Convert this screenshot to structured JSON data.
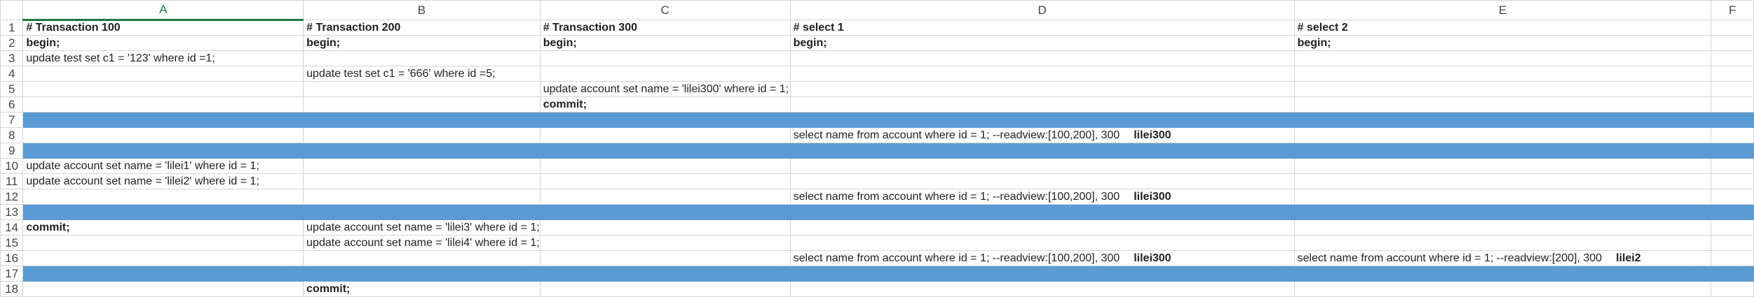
{
  "columns": [
    "A",
    "B",
    "C",
    "D",
    "E",
    "F"
  ],
  "rows": [
    {
      "num": "1",
      "band": false,
      "cells": [
        {
          "text": "# Transaction 100",
          "bold": true
        },
        {
          "text": "# Transaction 200",
          "bold": true
        },
        {
          "text": "# Transaction 300",
          "bold": true
        },
        {
          "text": "# select 1",
          "bold": true
        },
        {
          "text": "# select 2",
          "bold": true
        },
        {
          "text": ""
        }
      ]
    },
    {
      "num": "2",
      "band": false,
      "cells": [
        {
          "text": "begin;",
          "bold": true
        },
        {
          "text": "begin;",
          "bold": true
        },
        {
          "text": "begin;",
          "bold": true
        },
        {
          "text": "begin;",
          "bold": true
        },
        {
          "text": "begin;",
          "bold": true
        },
        {
          "text": ""
        }
      ]
    },
    {
      "num": "3",
      "band": false,
      "cells": [
        {
          "text": "update test set c1 = '123' where id =1;"
        },
        {
          "text": ""
        },
        {
          "text": ""
        },
        {
          "text": ""
        },
        {
          "text": ""
        },
        {
          "text": ""
        }
      ]
    },
    {
      "num": "4",
      "band": false,
      "cells": [
        {
          "text": ""
        },
        {
          "text": "update test set c1 = '666' where id =5;"
        },
        {
          "text": ""
        },
        {
          "text": ""
        },
        {
          "text": ""
        },
        {
          "text": ""
        }
      ]
    },
    {
      "num": "5",
      "band": false,
      "cells": [
        {
          "text": ""
        },
        {
          "text": ""
        },
        {
          "text": "update account set name = 'lilei300' where id = 1;"
        },
        {
          "text": ""
        },
        {
          "text": ""
        },
        {
          "text": ""
        }
      ]
    },
    {
      "num": "6",
      "band": false,
      "cells": [
        {
          "text": ""
        },
        {
          "text": ""
        },
        {
          "text": "commit;",
          "bold": true
        },
        {
          "text": ""
        },
        {
          "text": ""
        },
        {
          "text": ""
        }
      ]
    },
    {
      "num": "7",
      "band": true,
      "cells": [
        {
          "text": ""
        },
        {
          "text": ""
        },
        {
          "text": ""
        },
        {
          "text": ""
        },
        {
          "text": ""
        },
        {
          "text": ""
        }
      ]
    },
    {
      "num": "8",
      "band": false,
      "cells": [
        {
          "text": ""
        },
        {
          "text": ""
        },
        {
          "text": ""
        },
        {
          "text": "select name from account where id = 1;   --readview:[100,200], 300",
          "result": "lilei300"
        },
        {
          "text": ""
        },
        {
          "text": ""
        }
      ]
    },
    {
      "num": "9",
      "band": true,
      "cells": [
        {
          "text": ""
        },
        {
          "text": ""
        },
        {
          "text": ""
        },
        {
          "text": ""
        },
        {
          "text": ""
        },
        {
          "text": ""
        }
      ]
    },
    {
      "num": "10",
      "band": false,
      "cells": [
        {
          "text": "update account set name = 'lilei1' where id = 1;"
        },
        {
          "text": ""
        },
        {
          "text": ""
        },
        {
          "text": ""
        },
        {
          "text": ""
        },
        {
          "text": ""
        }
      ]
    },
    {
      "num": "11",
      "band": false,
      "cells": [
        {
          "text": "update account set name = 'lilei2' where id = 1;"
        },
        {
          "text": ""
        },
        {
          "text": ""
        },
        {
          "text": ""
        },
        {
          "text": ""
        },
        {
          "text": ""
        }
      ]
    },
    {
      "num": "12",
      "band": false,
      "cells": [
        {
          "text": ""
        },
        {
          "text": ""
        },
        {
          "text": ""
        },
        {
          "text": "select name from account where id = 1;   --readview:[100,200], 300",
          "result": "lilei300"
        },
        {
          "text": ""
        },
        {
          "text": ""
        }
      ]
    },
    {
      "num": "13",
      "band": true,
      "cells": [
        {
          "text": ""
        },
        {
          "text": ""
        },
        {
          "text": ""
        },
        {
          "text": ""
        },
        {
          "text": ""
        },
        {
          "text": ""
        }
      ]
    },
    {
      "num": "14",
      "band": false,
      "cells": [
        {
          "text": "commit;",
          "bold": true
        },
        {
          "text": "update account set name = 'lilei3' where id = 1;"
        },
        {
          "text": ""
        },
        {
          "text": ""
        },
        {
          "text": ""
        },
        {
          "text": ""
        }
      ]
    },
    {
      "num": "15",
      "band": false,
      "cells": [
        {
          "text": ""
        },
        {
          "text": "update account set name = 'lilei4' where id = 1;"
        },
        {
          "text": ""
        },
        {
          "text": ""
        },
        {
          "text": ""
        },
        {
          "text": ""
        }
      ]
    },
    {
      "num": "16",
      "band": false,
      "cells": [
        {
          "text": ""
        },
        {
          "text": ""
        },
        {
          "text": ""
        },
        {
          "text": "select name from account where id = 1;   --readview:[100,200], 300",
          "result": "lilei300"
        },
        {
          "text": "select name from account where id = 1;   --readview:[200], 300",
          "result": "lilei2"
        },
        {
          "text": ""
        }
      ]
    },
    {
      "num": "17",
      "band": true,
      "cells": [
        {
          "text": ""
        },
        {
          "text": ""
        },
        {
          "text": ""
        },
        {
          "text": ""
        },
        {
          "text": ""
        },
        {
          "text": ""
        }
      ]
    },
    {
      "num": "18",
      "band": false,
      "cells": [
        {
          "text": ""
        },
        {
          "text": "commit;",
          "bold": true
        },
        {
          "text": ""
        },
        {
          "text": ""
        },
        {
          "text": ""
        },
        {
          "text": ""
        }
      ]
    }
  ],
  "colors": {
    "band": "#5b9bd5",
    "selected_header": "#1e7a3a",
    "gridline": "#d4d4d4"
  }
}
